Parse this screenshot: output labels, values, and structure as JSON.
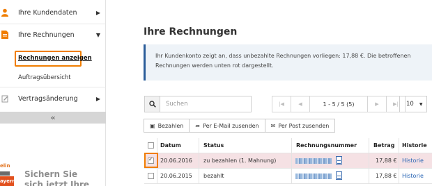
{
  "sidebar": {
    "items": [
      {
        "label": "Ihre Kundendaten",
        "icon": "user-icon"
      },
      {
        "label": "Ihre Rechnungen",
        "icon": "document-icon"
      },
      {
        "label": "Vertragsänderung",
        "icon": "edit-icon"
      }
    ],
    "subitems": [
      {
        "label": "Rechnungen anzeigen"
      },
      {
        "label": "Auftragsübersicht"
      }
    ],
    "collapse_label": "«",
    "promo_text": "Sichern Sie sich jetzt Ihre",
    "promo_img_text": [
      "elin",
      "ayern"
    ]
  },
  "main": {
    "title": "Ihre Rechnungen",
    "info": "Ihr Kundenkonto zeigt an, dass unbezahlte Rechnungen vorliegen: 17,88 €. Die betroffenen Rechnungen werden unten rot dargestellt.",
    "search_placeholder": "Suchen",
    "pager_info": "1 - 5 / 5 (5)",
    "per_page": "10",
    "actions": {
      "pay": "Bezahlen",
      "email": "Per E-Mail zusenden",
      "post": "Per Post zusenden"
    }
  },
  "table": {
    "headers": [
      "Datum",
      "Status",
      "Rechnungsnummer",
      "Betrag",
      "Historie"
    ],
    "rows": [
      {
        "date": "20.06.2016",
        "status": "zu bezahlen (1. Mahnung)",
        "amount": "17,88 €",
        "history": "Historie",
        "checked": true
      },
      {
        "date": "20.06.2015",
        "status": "bezahlt",
        "amount": "17,88 €",
        "history": "Historie",
        "checked": false
      }
    ]
  },
  "colors": {
    "accent_orange": "#f07d00",
    "link_blue": "#2a66b5",
    "unpaid_row": "#f5e1e4",
    "info_border": "#2b5d9a"
  }
}
